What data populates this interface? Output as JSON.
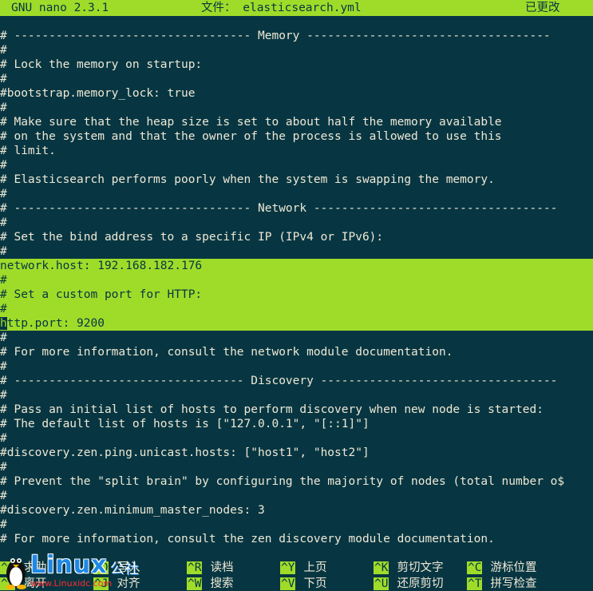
{
  "colors": {
    "background": "#073642",
    "highlight": "#9fdc2a",
    "text": "#eee8d5",
    "logo_blue": "#1e88e5",
    "logo_red": "#ff2d2d"
  },
  "titlebar": {
    "app": "GNU nano 2.3.1",
    "file": "文件： elasticsearch.yml",
    "status": "已更改"
  },
  "editor": {
    "lines": [
      {
        "text": "# ---------------------------------- Memory -----------------------------------",
        "selected": false
      },
      {
        "text": "#",
        "selected": false
      },
      {
        "text": "# Lock the memory on startup:",
        "selected": false
      },
      {
        "text": "#",
        "selected": false
      },
      {
        "text": "#bootstrap.memory_lock: true",
        "selected": false
      },
      {
        "text": "#",
        "selected": false
      },
      {
        "text": "# Make sure that the heap size is set to about half the memory available",
        "selected": false
      },
      {
        "text": "# on the system and that the owner of the process is allowed to use this",
        "selected": false
      },
      {
        "text": "# limit.",
        "selected": false
      },
      {
        "text": "#",
        "selected": false
      },
      {
        "text": "# Elasticsearch performs poorly when the system is swapping the memory.",
        "selected": false
      },
      {
        "text": "#",
        "selected": false
      },
      {
        "text": "# ---------------------------------- Network -----------------------------------",
        "selected": false
      },
      {
        "text": "#",
        "selected": false
      },
      {
        "text": "# Set the bind address to a specific IP (IPv4 or IPv6):",
        "selected": false
      },
      {
        "text": "#",
        "selected": false
      },
      {
        "text": "network.host: 192.168.182.176",
        "selected": true
      },
      {
        "text": "#",
        "selected": true
      },
      {
        "text": "# Set a custom port for HTTP:",
        "selected": true
      },
      {
        "text": "#",
        "selected": true
      },
      {
        "text": "http.port: 9200",
        "selected": true,
        "cursor_at_start": true
      },
      {
        "text": "#",
        "selected": false
      },
      {
        "text": "# For more information, consult the network module documentation.",
        "selected": false
      },
      {
        "text": "#",
        "selected": false
      },
      {
        "text": "# --------------------------------- Discovery ----------------------------------",
        "selected": false
      },
      {
        "text": "#",
        "selected": false
      },
      {
        "text": "# Pass an initial list of hosts to perform discovery when new node is started:",
        "selected": false
      },
      {
        "text": "# The default list of hosts is [\"127.0.0.1\", \"[::1]\"]",
        "selected": false
      },
      {
        "text": "#",
        "selected": false
      },
      {
        "text": "#discovery.zen.ping.unicast.hosts: [\"host1\", \"host2\"]",
        "selected": false
      },
      {
        "text": "#",
        "selected": false
      },
      {
        "text": "# Prevent the \"split brain\" by configuring the majority of nodes (total number o$",
        "selected": false
      },
      {
        "text": "#",
        "selected": false
      },
      {
        "text": "#discovery.zen.minimum_master_nodes: 3",
        "selected": false
      },
      {
        "text": "#",
        "selected": false
      },
      {
        "text": "# For more information, consult the zen discovery module documentation.",
        "selected": false
      }
    ]
  },
  "shortcuts": [
    {
      "key": "^G",
      "label": "求助"
    },
    {
      "key": "^X",
      "label": "离开"
    },
    {
      "key": "^O",
      "label": "写入"
    },
    {
      "key": "^J",
      "label": "对齐"
    },
    {
      "key": "^R",
      "label": "读档"
    },
    {
      "key": "^W",
      "label": "搜索"
    },
    {
      "key": "^Y",
      "label": "上页"
    },
    {
      "key": "^V",
      "label": "下页"
    },
    {
      "key": "^K",
      "label": "剪切文字"
    },
    {
      "key": "^U",
      "label": "还原剪切"
    },
    {
      "key": "^C",
      "label": "游标位置"
    },
    {
      "key": "^T",
      "label": "拼写检查"
    }
  ],
  "watermark": {
    "logo_text": "Linux",
    "logo_cn": "公社",
    "url": "www.Linuxidc.com",
    "icon": "tux-penguin-icon"
  }
}
